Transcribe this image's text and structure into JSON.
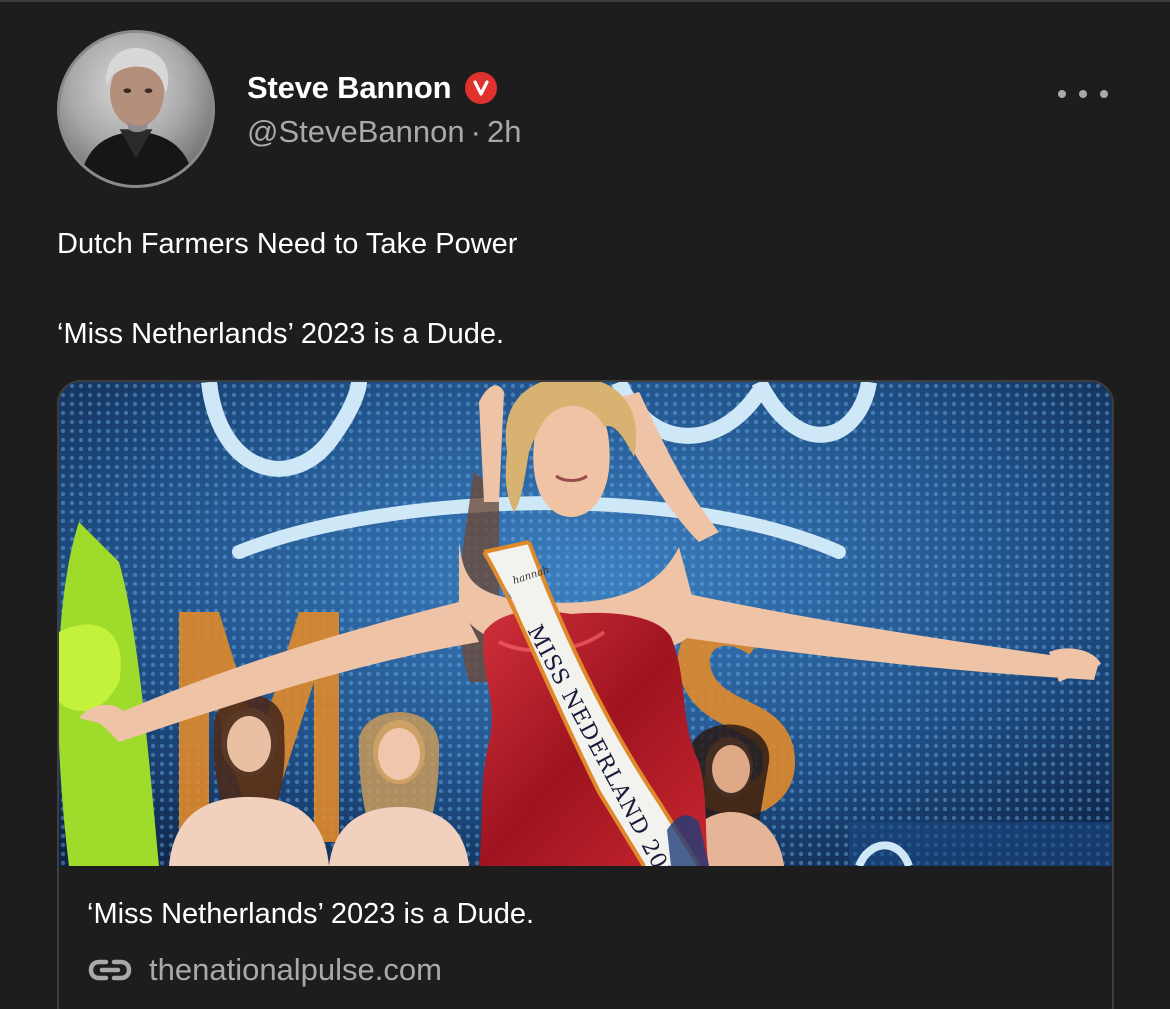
{
  "author": {
    "name": "Steve Bannon",
    "handle": "@SteveBannon",
    "time": "2h",
    "separator": "·",
    "verified_badge": "V",
    "badge_color": "#e0312e",
    "avatar_icon": "user-photo"
  },
  "post": {
    "line1": "Dutch Farmers Need to Take Power",
    "line2": "‘Miss Netherlands’ 2023 is a Dude."
  },
  "link_card": {
    "image_alt": "Pageant winner in red dress wearing a Miss Nederland sash",
    "sash_text": "MISS NEDERLAND 202",
    "sash_brand": "hannah",
    "backdrop_text": "MISS",
    "title": "‘Miss Netherlands’ 2023 is a Dude.",
    "domain": "thenationalpulse.com",
    "link_icon": "link-icon"
  },
  "colors": {
    "background": "#1d1d1d",
    "secondary_text": "#a9a9a9",
    "card_border": "#3e3e3e"
  }
}
